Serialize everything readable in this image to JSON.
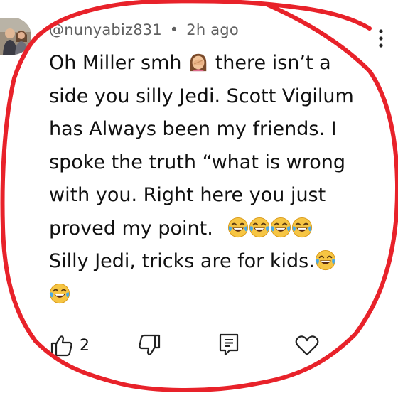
{
  "comment": {
    "username": "@nunyabiz831",
    "separator": "•",
    "timestamp": "2h ago",
    "lines": [
      "Oh Miller smh",
      "there isn’t a",
      "side you silly Jedi.  Scott Vigilum",
      "has Always been my friends. I",
      "spoke the truth “what is wrong",
      "with you.  Right here you just",
      "proved my point.",
      "Silly Jedi, tricks are for kids."
    ],
    "emojis": {
      "facepalm": "woman-facepalming-emoji",
      "laughing": "tears-of-joy-emoji"
    }
  },
  "actions": {
    "like_count": "2",
    "like_icon": "thumbs-up-icon",
    "dislike_icon": "thumbs-down-icon",
    "reply_icon": "reply-comment-icon",
    "heart_icon": "heart-icon"
  },
  "colors": {
    "annotation_red": "#e8222a",
    "meta_gray": "#606060",
    "text": "#111111"
  }
}
